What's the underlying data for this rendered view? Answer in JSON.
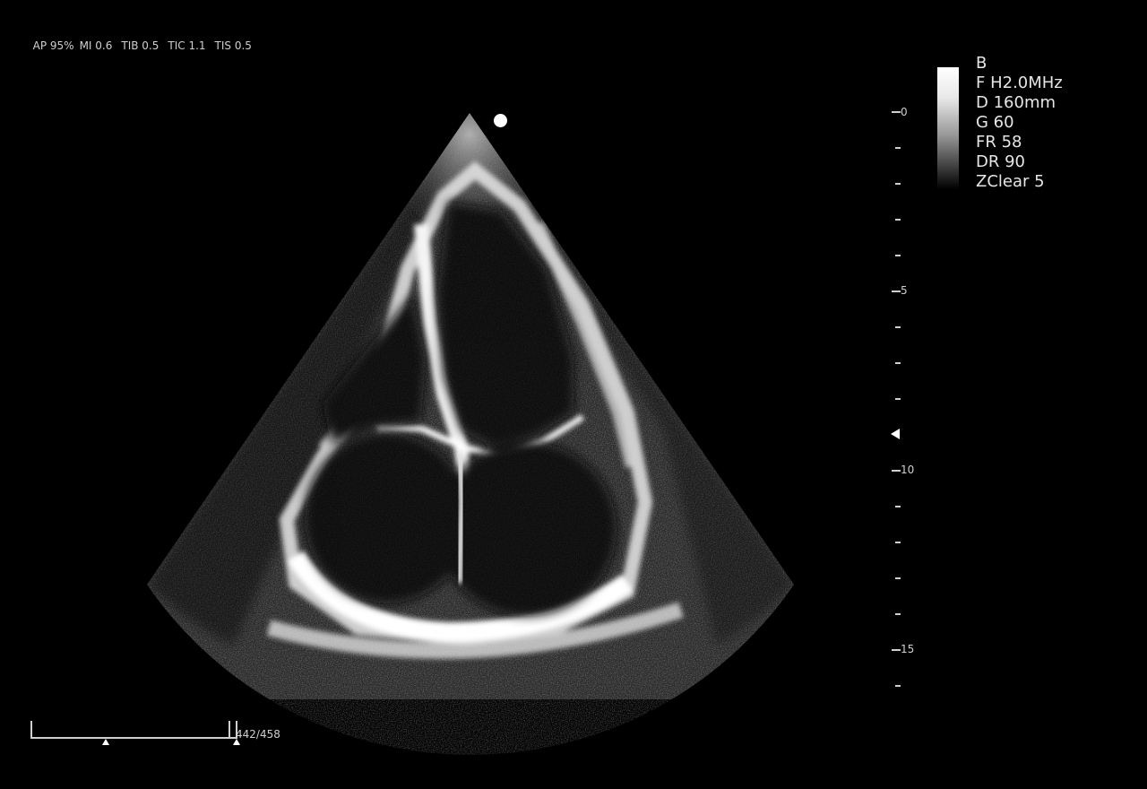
{
  "top_params": {
    "ap": "AP 95%",
    "mi": "MI 0.6",
    "tib": "TIB 0.5",
    "tic": "TIC 1.1",
    "tis": "TIS 0.5"
  },
  "settings": {
    "mode": "B",
    "frequency": "F H2.0MHz",
    "depth": "D 160mm",
    "gain": "G 60",
    "frame_rate": "FR 58",
    "dynamic_range": "DR 90",
    "zclear": "ZClear 5"
  },
  "depth_scale": {
    "labels": [
      "0",
      "5",
      "10",
      "15"
    ]
  },
  "cine": {
    "frame_counter": "442/458",
    "current_frame": 442,
    "total_frames": 458
  },
  "colors": {
    "background": "#000000",
    "text": "#cfcfcf",
    "tissue": "#ffffff"
  },
  "icons": {
    "orientation_marker": "orientation-dot-icon",
    "focus_marker": "focus-triangle-icon"
  }
}
